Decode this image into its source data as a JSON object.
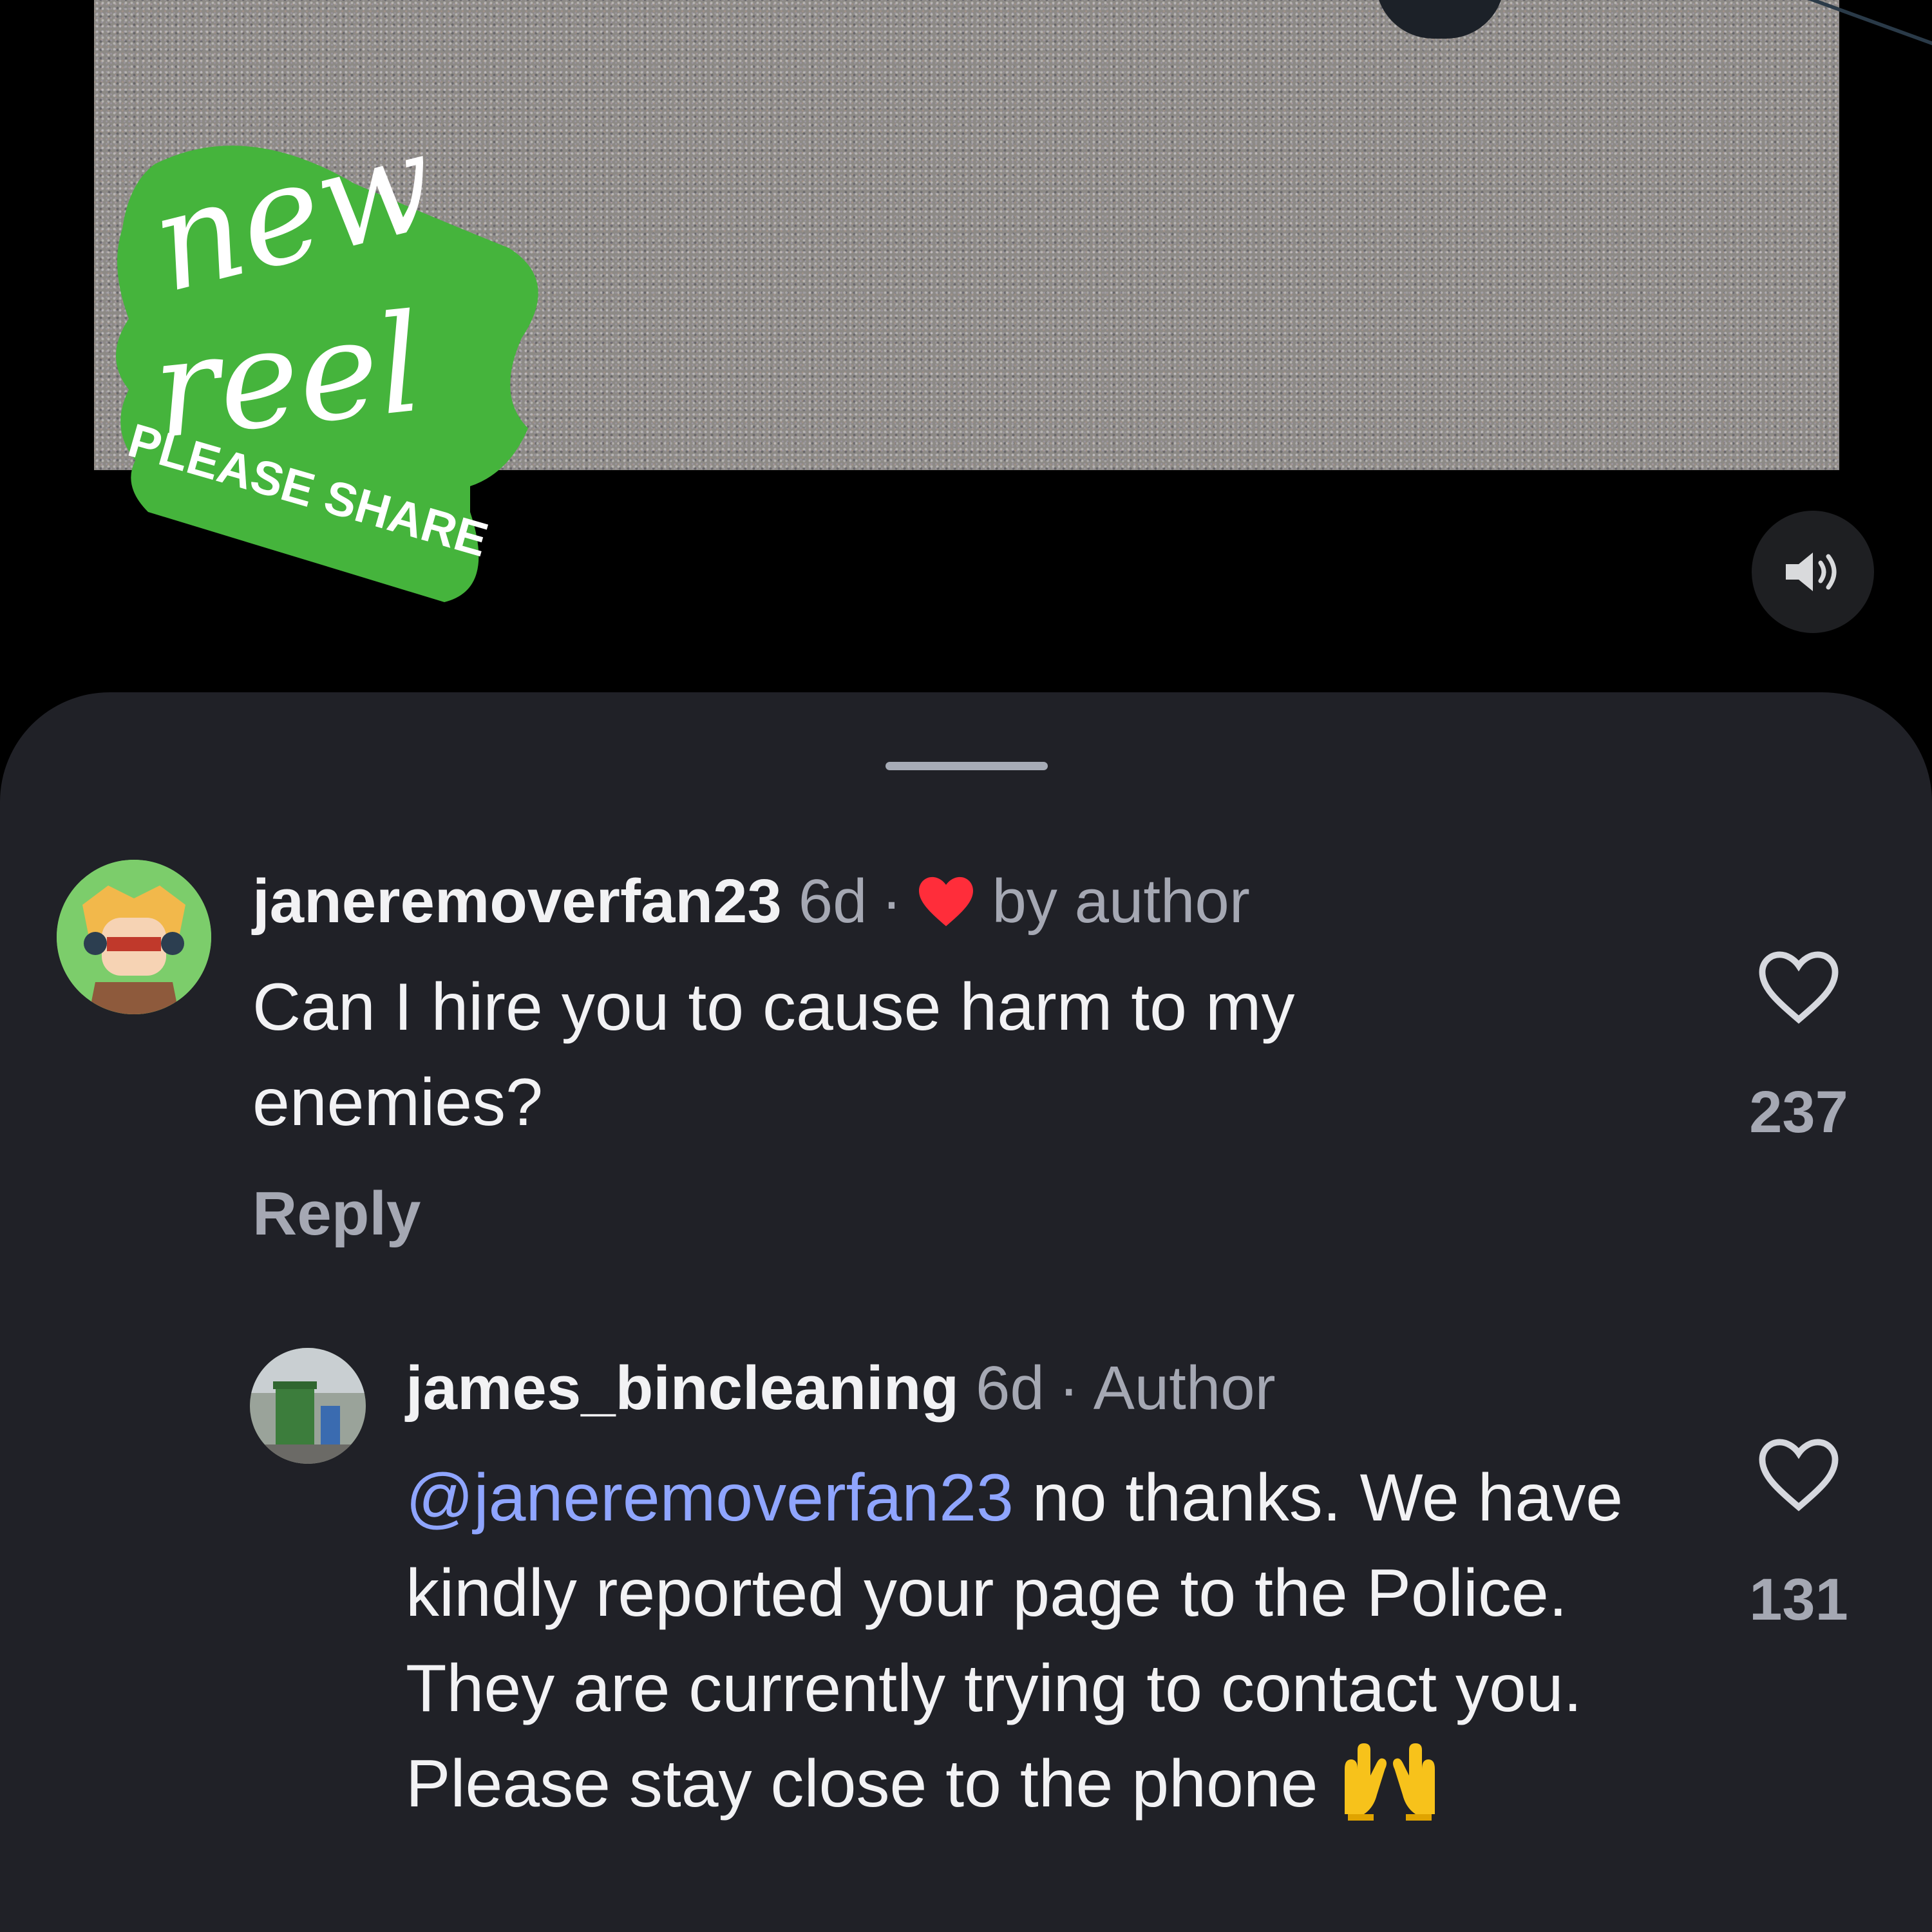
{
  "video": {
    "sticker": {
      "line1": "new",
      "line2": "reel",
      "line3": "PLEASE SHARE",
      "color": "#45b43c"
    },
    "sound_icon": "speaker-volume-icon"
  },
  "comments": [
    {
      "username": "janeremoverfan23",
      "time": "6d",
      "separator": "·",
      "badge": "by author",
      "badge_icon": "red-heart-icon",
      "text": "Can I hire you to cause harm to my enemies?",
      "reply_label": "Reply",
      "like_icon": "heart-outline-icon",
      "likes": "237"
    },
    {
      "username": "james_bincleaning",
      "time": "6d",
      "separator": "·",
      "badge": "Author",
      "mention": "@janeremoverfan23",
      "text": " no thanks. We have kindly reported your page to the Police. They are currently trying to contact you. Please stay close to the phone",
      "emoji": "raised-hands-emoji",
      "like_icon": "heart-outline-icon",
      "likes": "131"
    }
  ],
  "colors": {
    "sheet_background": "#202127",
    "mention": "#8fa5ff",
    "muted_text": "#a5a8b3",
    "badge_heart": "#ff2d3a"
  }
}
